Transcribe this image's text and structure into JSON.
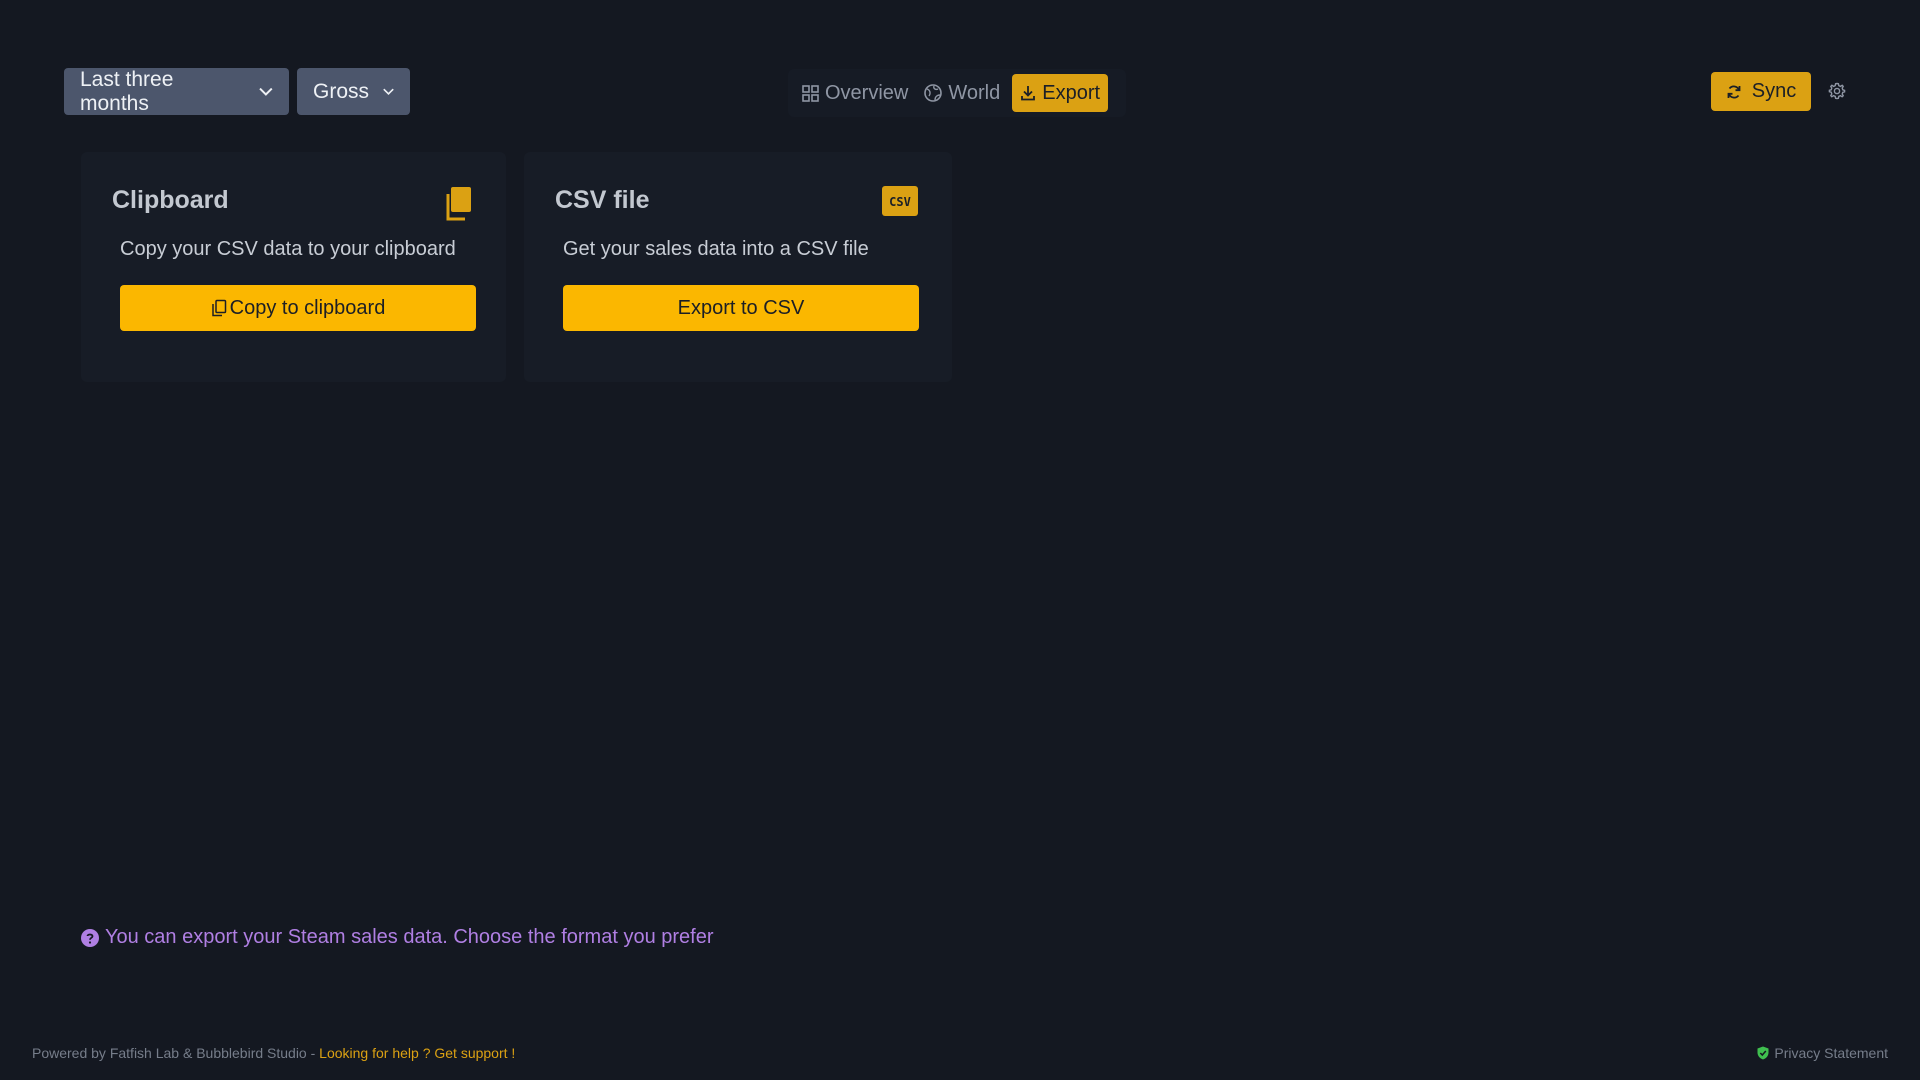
{
  "filters": {
    "period_label": "Last three months",
    "revenue_label": "Gross"
  },
  "nav": {
    "tabs": [
      {
        "label": "Overview",
        "icon": "grid-icon"
      },
      {
        "label": "World",
        "icon": "globe-icon"
      },
      {
        "label": "Export",
        "icon": "download-icon",
        "active": true
      }
    ]
  },
  "sync": {
    "label": "Sync",
    "icon": "sync-icon"
  },
  "settings": {
    "icon": "gear-icon"
  },
  "cards": [
    {
      "title": "Clipboard",
      "icon": "clipboard-copy-icon",
      "description": "Copy your CSV data to your clipboard",
      "button_label": "Copy to clipboard"
    },
    {
      "title": "CSV file",
      "icon": "csv-file-icon",
      "icon_text": "CSV",
      "description": "Get your sales data into a CSV file",
      "button_label": "Export to CSV"
    }
  ],
  "info": {
    "text": "You can export your Steam sales data. Choose the format you prefer"
  },
  "footer": {
    "powered_by": "Powered by Fatfish Lab & Bubblebird Studio - ",
    "support_link": "Looking for help ? Get support !",
    "privacy": "Privacy Statement"
  },
  "colors": {
    "background": "#141821",
    "accent": "#fbb700",
    "accent_dark": "#dba113",
    "info": "#b07fe3",
    "privacy_shield": "#3fbf4f"
  }
}
